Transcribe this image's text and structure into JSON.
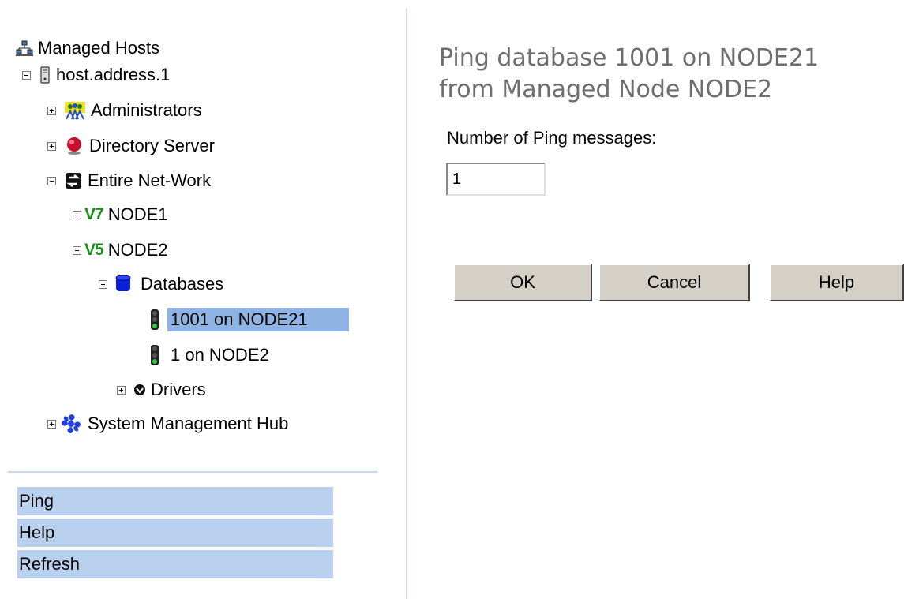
{
  "tree": {
    "root": {
      "label": "Managed Hosts",
      "icon": "managed-hosts-icon"
    },
    "host": {
      "label": "host.address.1",
      "icon": "server-icon"
    },
    "administrators": {
      "label": "Administrators",
      "icon": "administrators-icon"
    },
    "directory_server": {
      "label": "Directory Server",
      "icon": "red-ball-icon"
    },
    "entire_network": {
      "label": "Entire Net-Work",
      "icon": "entire-network-icon"
    },
    "node1": {
      "badge": "V7",
      "label": "NODE1"
    },
    "node2": {
      "badge": "V5",
      "label": "NODE2"
    },
    "databases": {
      "label": "Databases",
      "icon": "database-icon"
    },
    "db_1001": {
      "label": "1001 on NODE21",
      "icon": "traffic-light-icon",
      "selected": true
    },
    "db_1": {
      "label": "1 on NODE2",
      "icon": "traffic-light-icon"
    },
    "drivers": {
      "label": "Drivers",
      "icon": "drivers-icon"
    },
    "smh": {
      "label": "System Management Hub",
      "icon": "smh-icon"
    }
  },
  "actions": [
    {
      "label": "Ping"
    },
    {
      "label": "Help"
    },
    {
      "label": "Refresh"
    }
  ],
  "dialog": {
    "title_line1": "Ping database 1001 on NODE21",
    "title_line2": "from Managed Node NODE2",
    "field_label": "Number of Ping messages:",
    "field_value": "1",
    "buttons": {
      "ok": "OK",
      "cancel": "Cancel",
      "help": "Help"
    }
  },
  "colors": {
    "selection": "#8fb4e3",
    "action_bg": "#b9d1ee",
    "version_badge": "#1a8c1a"
  }
}
